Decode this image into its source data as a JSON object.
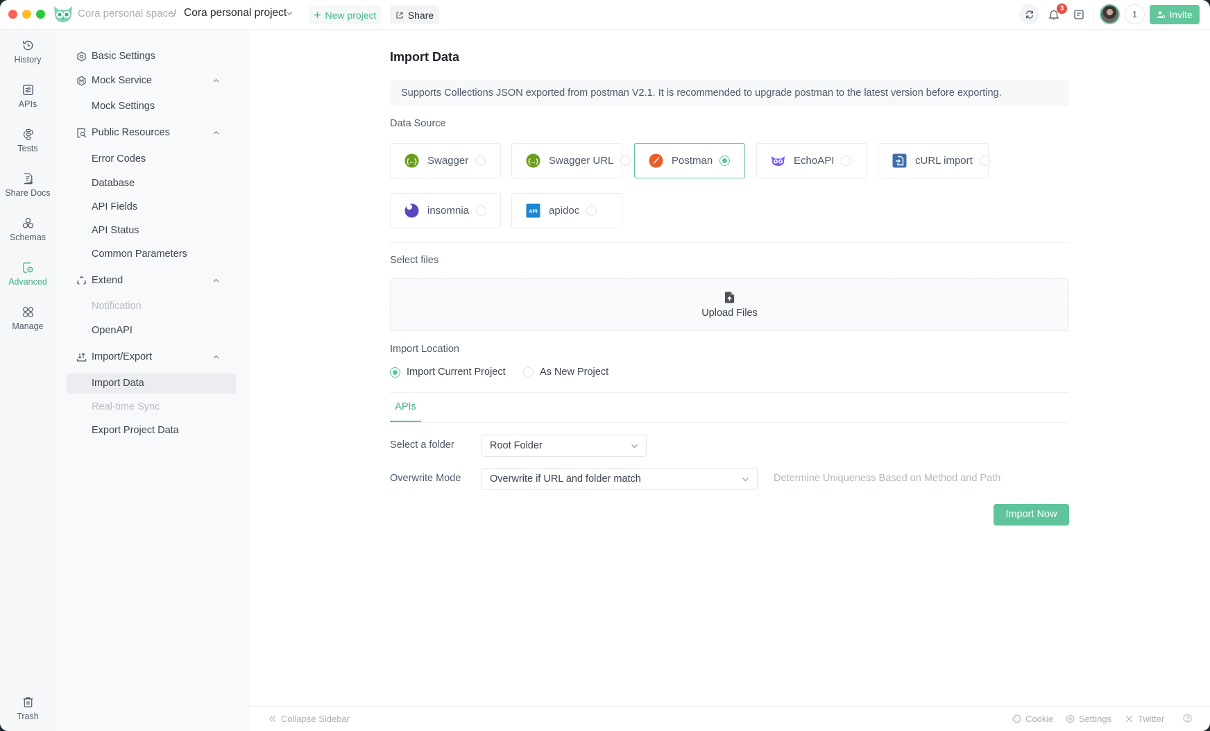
{
  "window": {
    "controls": [
      "close",
      "minimize",
      "maximize"
    ]
  },
  "header": {
    "workspace": "Cora personal space",
    "separator": "/",
    "project": "Cora personal project",
    "new_project_label": "New project",
    "share_label": "Share",
    "notification_count": "3",
    "member_count": "1",
    "invite_label": "Invite",
    "icons": [
      "owl-logo",
      "chevron-down-icon",
      "plus-icon",
      "share-icon",
      "refresh-icon",
      "bell-icon",
      "document-icon",
      "avatar",
      "invite-user-icon"
    ]
  },
  "rail": {
    "items": [
      {
        "label": "History",
        "icon": "history-icon",
        "active": false
      },
      {
        "label": "APIs",
        "icon": "apis-icon",
        "active": false
      },
      {
        "label": "Tests",
        "icon": "tests-icon",
        "active": false
      },
      {
        "label": "Share Docs",
        "icon": "share-docs-icon",
        "active": false
      },
      {
        "label": "Schemas",
        "icon": "schemas-icon",
        "active": false
      },
      {
        "label": "Advanced",
        "icon": "advanced-icon",
        "active": true
      },
      {
        "label": "Manage",
        "icon": "manage-icon",
        "active": false
      }
    ],
    "trash_label": "Trash"
  },
  "sidebar": {
    "basic_settings": "Basic Settings",
    "mock_service": {
      "label": "Mock Service",
      "expanded": true,
      "children": [
        "Mock Settings"
      ]
    },
    "public_resources": {
      "label": "Public Resources",
      "expanded": true,
      "children": [
        "Error Codes",
        "Database",
        "API Fields",
        "API Status",
        "Common Parameters"
      ]
    },
    "extend": {
      "label": "Extend",
      "expanded": true,
      "children": [
        "Notification",
        "OpenAPI"
      ]
    },
    "import_export": {
      "label": "Import/Export",
      "expanded": true,
      "children": [
        "Import Data",
        "Real-time Sync",
        "Export Project Data"
      ]
    },
    "active_item": "Import Data",
    "disabled_items": [
      "Notification",
      "Real-time Sync"
    ]
  },
  "main": {
    "title": "Import Data",
    "info": "Supports Collections JSON exported from postman V2.1. It is recommended to upgrade postman to the latest version before exporting.",
    "data_source_label": "Data Source",
    "sources": [
      {
        "label": "Swagger",
        "icon": "swagger-icon",
        "selected": false
      },
      {
        "label": "Swagger URL",
        "icon": "swagger-icon",
        "selected": false
      },
      {
        "label": "Postman",
        "icon": "postman-icon",
        "selected": true
      },
      {
        "label": "EchoAPI",
        "icon": "echoapi-icon",
        "selected": false
      },
      {
        "label": "cURL import",
        "icon": "curl-icon",
        "selected": false
      },
      {
        "label": "insomnia",
        "icon": "insomnia-icon",
        "selected": false
      },
      {
        "label": "apidoc",
        "icon": "apidoc-icon",
        "selected": false
      }
    ],
    "apidoc_icon_text": "API",
    "select_files_label": "Select files",
    "upload_label": "Upload Files",
    "import_location_label": "Import Location",
    "import_location_options": [
      {
        "label": "Import Current Project",
        "selected": true
      },
      {
        "label": "As New Project",
        "selected": false
      }
    ],
    "tabs": [
      {
        "label": "APIs",
        "active": true
      }
    ],
    "folder_label": "Select a folder",
    "folder_value": "Root Folder",
    "overwrite_label": "Overwrite Mode",
    "overwrite_value": "Overwrite if URL and folder match",
    "overwrite_hint": "Determine Uniqueness Based on Method and Path",
    "import_button": "Import Now"
  },
  "footer": {
    "collapse_label": "Collapse Sidebar",
    "links": [
      "Cookie",
      "Settings",
      "Twitter"
    ]
  },
  "colors": {
    "accent": "#5ec49b",
    "accent_text": "#3fae7e",
    "badge": "#f04a3a",
    "swagger": "#6b9d1b",
    "postman": "#ef5b25",
    "echoapi": "#7b5cf5",
    "curl": "#3d6fae",
    "insomnia": "#5849be",
    "apidoc": "#1f86d1"
  }
}
